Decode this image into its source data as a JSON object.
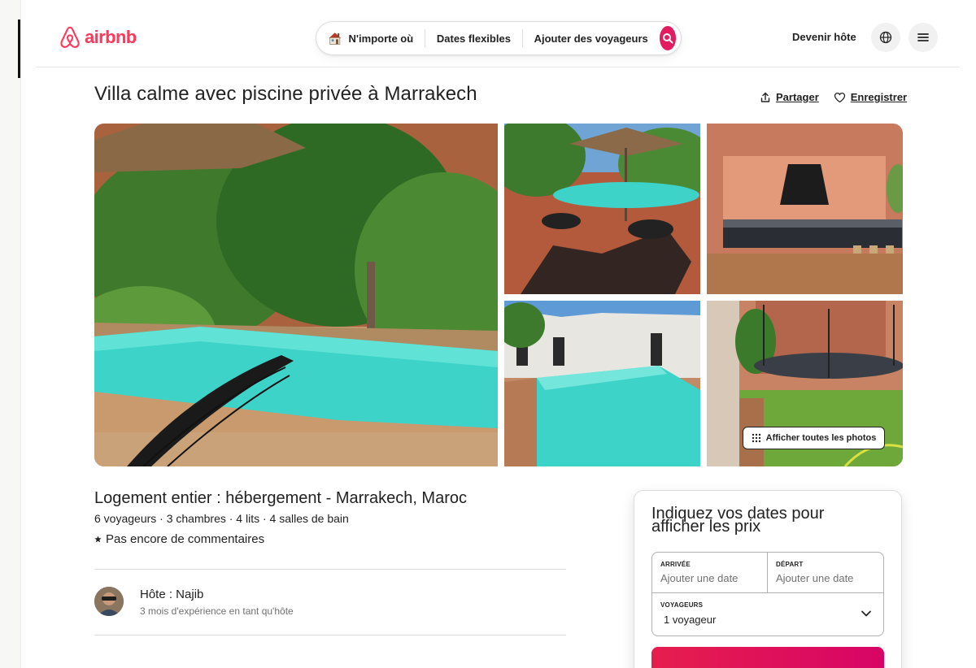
{
  "header": {
    "logo_text": "airbnb",
    "search": {
      "anywhere": "N'importe où",
      "flexible_dates": "Dates flexibles",
      "add_guests": "Ajouter des voyageurs"
    },
    "host_link": "Devenir hôte"
  },
  "listing": {
    "title": "Villa calme avec piscine privée à Marrakech",
    "share_label": "Partager",
    "save_label": "Enregistrer",
    "show_all_photos": "Afficher toutes les photos",
    "subtitle": "Logement entier : hébergement - Marrakech, Maroc",
    "details": "6 voyageurs · 3 chambres · 4 lits · 4 salles de bain",
    "reviews": "Pas encore de commentaires",
    "host_name": "Hôte : Najib",
    "host_experience": "3 mois d'expérience en tant qu'hôte"
  },
  "booking": {
    "title": "Indiquez vos dates pour afficher les prix",
    "checkin_label": "ARRIVÉE",
    "checkin_placeholder": "Ajouter une date",
    "checkout_label": "DÉPART",
    "checkout_placeholder": "Ajouter une date",
    "guests_label": "VOYAGEURS",
    "guests_value": "1 voyageur"
  },
  "colors": {
    "brand": "#ff385c",
    "search_button": "#e31c5f",
    "reserve_button": "#e61e4d"
  },
  "icons": [
    "airbnb-logo-icon",
    "house-icon",
    "search-icon",
    "globe-icon",
    "menu-icon",
    "share-icon",
    "heart-icon",
    "grid-icon",
    "star-icon",
    "chevron-down-icon"
  ]
}
